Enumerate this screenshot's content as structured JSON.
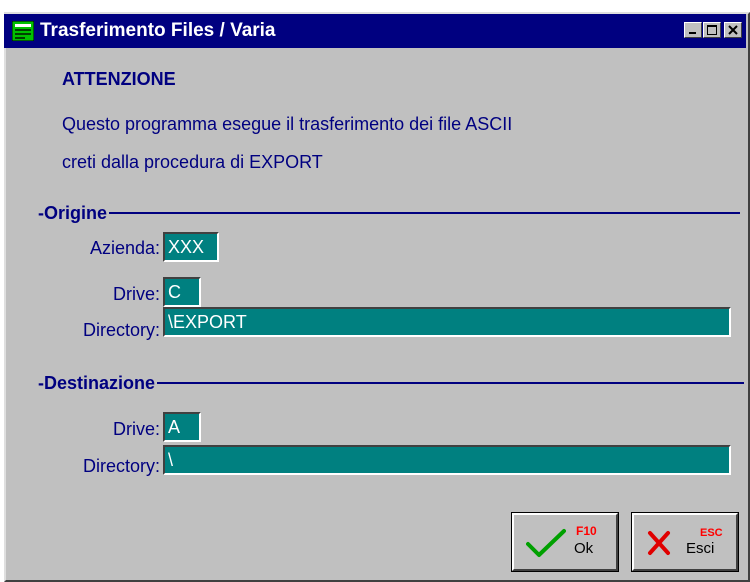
{
  "window": {
    "title": "Trasferimento Files / Varia",
    "icon": "app-window-icon",
    "controls": [
      "minimize-icon",
      "maximize-icon",
      "close-icon"
    ]
  },
  "message": {
    "heading": "ATTENZIONE",
    "line1": "Questo programma esegue il trasferimento dei file ASCII",
    "line2": "creti dalla procedura di EXPORT"
  },
  "origine": {
    "title": "-Origine",
    "azienda_label": "Azienda:",
    "azienda_value": "XXX",
    "drive_label": "Drive:",
    "drive_value": "C",
    "directory_label": "Directory:",
    "directory_value": "\\EXPORT"
  },
  "destinazione": {
    "title": "-Destinazione",
    "drive_label": "Drive:",
    "drive_value": "A",
    "directory_label": "Directory:",
    "directory_value": "\\"
  },
  "buttons": {
    "ok_key": "F10",
    "ok_label": "Ok",
    "ok_icon": "checkmark-icon",
    "esc_key": "ESC",
    "esc_label": "Esci",
    "esc_icon": "x-cross-icon"
  },
  "colors": {
    "titlebar": "#000080",
    "field_bg": "#008080",
    "text": "#000080",
    "window_bg": "#c0c0c0",
    "hotkey": "#ff0000"
  }
}
